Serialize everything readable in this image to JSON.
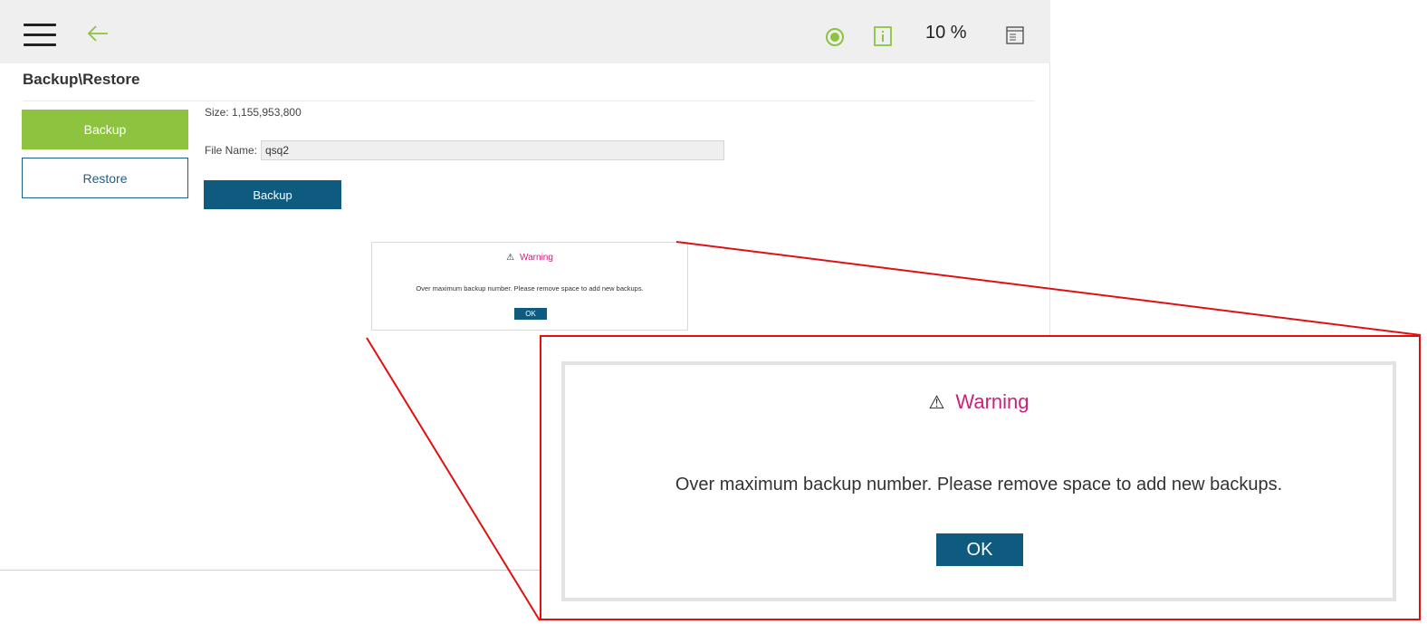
{
  "header": {
    "menu_icon": "hamburger-icon",
    "back_icon": "arrow-left-icon",
    "status_icon": "status-dot-icon",
    "info_icon": "info-icon",
    "speed": "10 %",
    "log_icon": "log-icon"
  },
  "page": {
    "title": "Backup\\Restore"
  },
  "sidebar": {
    "items": [
      {
        "label": "Backup",
        "active": true
      },
      {
        "label": "Restore",
        "active": false
      }
    ]
  },
  "backup": {
    "size_text": "Size: 1,155,953,800",
    "file_name_label": "File Name:",
    "file_name_value": "qsq2",
    "button_label": "Backup"
  },
  "dialog": {
    "warning_glyph": "⚠",
    "title": "Warning",
    "message": "Over maximum backup number. Please remove space to add new backups.",
    "ok_label": "OK"
  },
  "colors": {
    "accent_green": "#8dc33f",
    "primary_blue": "#0f5b80",
    "warning_title": "#c8227b",
    "zoom_highlight": "#e01010"
  }
}
